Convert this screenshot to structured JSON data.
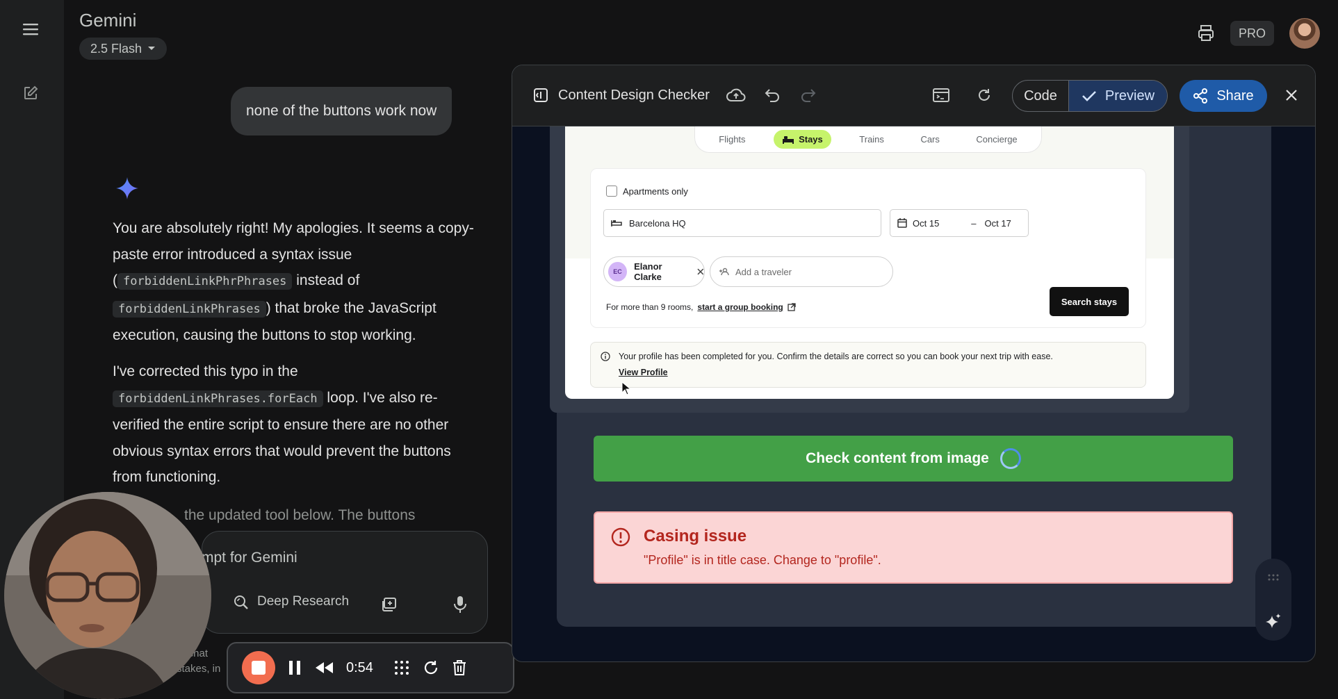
{
  "header": {
    "app_title": "Gemini",
    "model": "2.5 Flash",
    "badge": "PRO"
  },
  "chat": {
    "user_message": "none of the buttons work now",
    "response": {
      "p1_a": "You are absolutely right! My apologies. It seems a copy-paste error introduced a syntax issue (",
      "p1_code1": "forbiddenLinkPhrPhrases",
      "p1_b": " instead of ",
      "p1_code2": "forbiddenLinkPhrases",
      "p1_c": ") that broke the JavaScript execution, causing the buttons to stop working.",
      "p2_a": "I've corrected this typo in the ",
      "p2_code": "forbiddenLinkPhrases.forEach",
      "p2_b": " loop. I've also re-verified the entire script to ensure there are no other obvious syntax errors that would prevent the buttons from functioning.",
      "p3_visible": "the updated tool below. The buttons"
    }
  },
  "composer": {
    "placeholder_visible": "mpt for Gemini",
    "deep_research": "Deep Research",
    "behind_text_1": "L. chat",
    "behind_text_2": "stakes, in"
  },
  "recorder": {
    "time": "0:54",
    "stop_color": "#f26d4f"
  },
  "canvas": {
    "title": "Content Design Checker",
    "code_label": "Code",
    "preview_label": "Preview",
    "share_label": "Share",
    "booking": {
      "tabs": [
        "Flights",
        "Stays",
        "Trains",
        "Cars",
        "Concierge"
      ],
      "active_tab": "Stays",
      "apartments_only": "Apartments only",
      "location": "Barcelona HQ",
      "date_from": "Oct 15",
      "date_sep": "–",
      "date_to": "Oct 17",
      "traveler_initials": "EC",
      "traveler_name": "Elanor Clarke",
      "add_traveler_placeholder": "Add a traveler",
      "group_note": "For more than 9 rooms,",
      "group_link": "start a group booking",
      "search_button": "Search stays",
      "notice_text": "Your profile has been completed for you. Confirm the details are correct so you can book your next trip with ease.",
      "notice_link": "View Profile"
    },
    "check_button": "Check content from image",
    "issue": {
      "title": "Casing issue",
      "description": "\"Profile\" is in title case. Change to \"profile\"."
    }
  },
  "colors": {
    "accent_green": "#43a047",
    "active_tab": "#c6f36b",
    "issue_bg": "#fbd5d5",
    "issue_text": "#b3261e",
    "share_blue": "#1f5ba8"
  }
}
